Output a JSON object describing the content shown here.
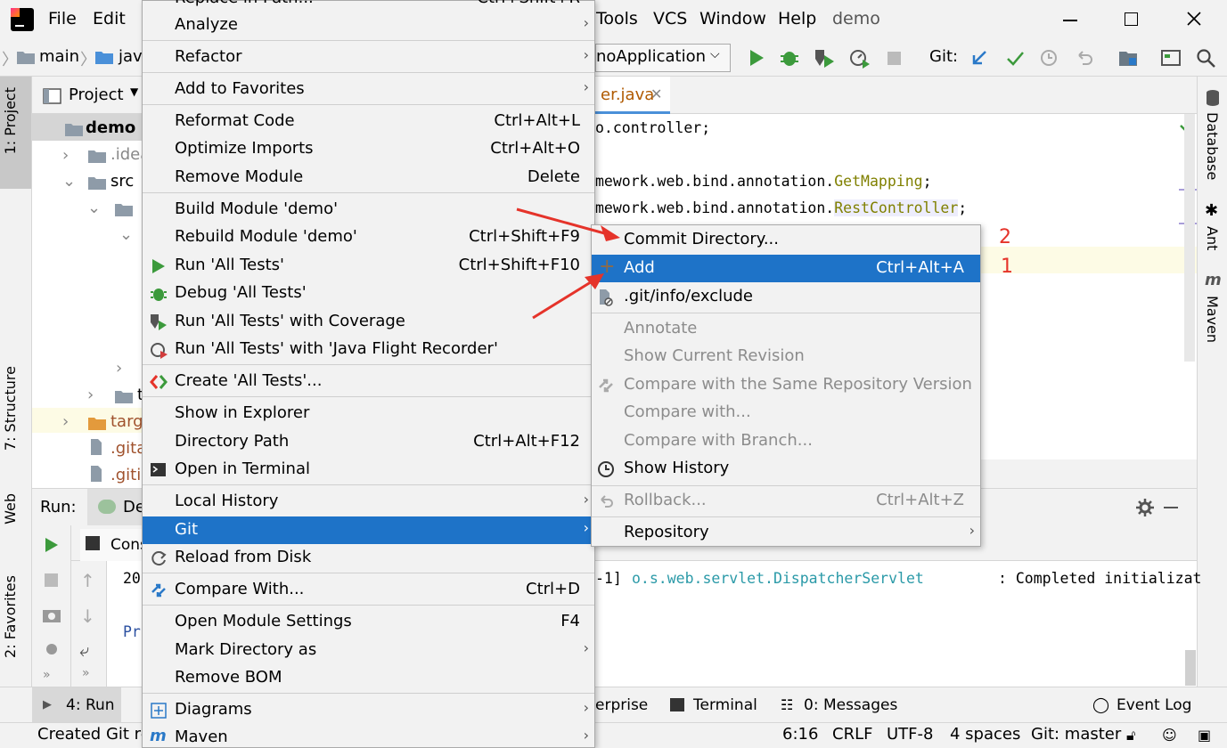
{
  "menubar": {
    "file": "File",
    "edit": "Edit",
    "tools": "Tools",
    "vcs": "VCS",
    "window": "Window",
    "help": "Help",
    "project_name": "demo"
  },
  "navbar": {
    "crumb_main": "main",
    "crumb_java": "java",
    "run_config": "noApplication",
    "git_label": "Git:"
  },
  "project_panel": {
    "title": "Project",
    "root": "demo",
    "items": [
      ".idea",
      "src",
      "t",
      "targ",
      ".gita",
      ".giti"
    ]
  },
  "editor": {
    "tab_name": "er.java",
    "lines": [
      "o.controller;",
      "",
      "mework.web.bind.annotation.",
      "mework.web.bind.annotation."
    ],
    "anno_get": "GetMapping",
    "anno_rest": "RestController",
    "semicolon": ";"
  },
  "left_tabs": {
    "project": "1: Project",
    "structure": "7: Structure",
    "web": "Web",
    "favorites": "2: Favorites"
  },
  "right_tabs": {
    "database": "Database",
    "ant": "Ant",
    "maven": "Maven"
  },
  "run_panel": {
    "label": "Run:",
    "tab": "De",
    "console_tab": "Cons",
    "log_prefix": "-1]",
    "log_class": "o.s.web.servlet.DispatcherServlet",
    "log_msg": ": Completed initializat",
    "line1": "20",
    "line2": "Pr"
  },
  "bottom_bar": {
    "run": "4: Run",
    "enterprise": "erprise",
    "terminal": "Terminal",
    "messages": "0: Messages",
    "event_log": "Event Log"
  },
  "status_bar": {
    "left": "Created Git re",
    "pos": "6:16",
    "crlf": "CRLF",
    "enc": "UTF-8",
    "indent": "4 spaces",
    "git": "Git: master"
  },
  "context_menu": {
    "top_cut": "Replace in Path...",
    "top_cut_sc": "Ctrl+Shift+R",
    "analyze": "Analyze",
    "refactor": "Refactor",
    "add_fav": "Add to Favorites",
    "reformat": "Reformat Code",
    "reformat_sc": "Ctrl+Alt+L",
    "optimize": "Optimize Imports",
    "optimize_sc": "Ctrl+Alt+O",
    "remove_module": "Remove Module",
    "remove_module_sc": "Delete",
    "build": "Build Module 'demo'",
    "rebuild": "Rebuild Module 'demo'",
    "rebuild_sc": "Ctrl+Shift+F9",
    "run_tests": "Run 'All Tests'",
    "run_tests_sc": "Ctrl+Shift+F10",
    "debug_tests": "Debug 'All Tests'",
    "coverage": "Run 'All Tests' with Coverage",
    "jfr": "Run 'All Tests' with 'Java Flight Recorder'",
    "create_tests": "Create 'All Tests'...",
    "show_explorer": "Show in Explorer",
    "dir_path": "Directory Path",
    "dir_path_sc": "Ctrl+Alt+F12",
    "terminal": "Open in Terminal",
    "local_history": "Local History",
    "git": "Git",
    "reload": "Reload from Disk",
    "compare": "Compare With...",
    "compare_sc": "Ctrl+D",
    "module_settings": "Open Module Settings",
    "module_settings_sc": "F4",
    "mark_dir": "Mark Directory as",
    "remove_bom": "Remove BOM",
    "diagrams": "Diagrams",
    "maven": "Maven"
  },
  "git_submenu": {
    "commit": "Commit Directory...",
    "add": "Add",
    "add_sc": "Ctrl+Alt+A",
    "exclude": ".git/info/exclude",
    "annotate": "Annotate",
    "show_rev": "Show Current Revision",
    "compare_same": "Compare with the Same Repository Version",
    "compare_with": "Compare with...",
    "compare_branch": "Compare with Branch...",
    "history": "Show History",
    "rollback": "Rollback...",
    "rollback_sc": "Ctrl+Alt+Z",
    "repository": "Repository"
  },
  "annotations": {
    "one": "1",
    "two": "2"
  },
  "colors": {
    "selection": "#1e73c8",
    "arrow": "#e5332a",
    "run_green": "#3c9a3c"
  }
}
